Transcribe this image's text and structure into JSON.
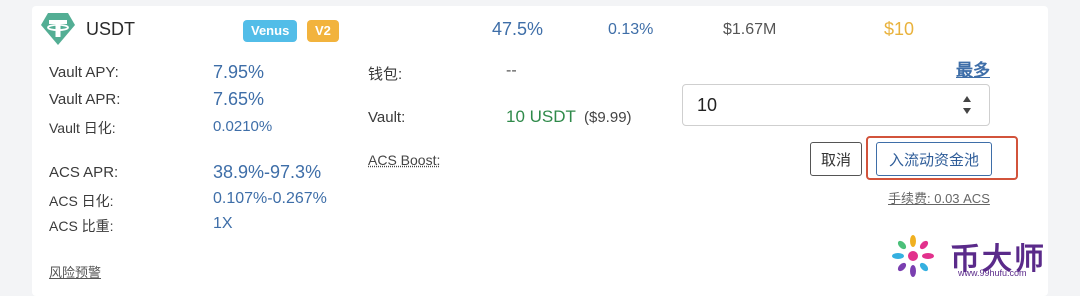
{
  "token": {
    "name": "USDT",
    "logo_icon": "tether-icon",
    "logo_color": "#53ae94"
  },
  "tags": {
    "venus": "Venus",
    "v2": "V2"
  },
  "header": {
    "apy": "47.5%",
    "daily": "0.13%",
    "tvl": "$1.67M",
    "price": "$10"
  },
  "stats": {
    "vault_apy_label": "Vault APY:",
    "vault_apy_value": "7.95%",
    "vault_apr_label": "Vault APR:",
    "vault_apr_value": "7.65%",
    "vault_daily_label": "Vault 日化:",
    "vault_daily_value": "0.0210%",
    "acs_apr_label": "ACS APR:",
    "acs_apr_value": "38.9%-97.3%",
    "acs_daily_label": "ACS 日化:",
    "acs_daily_value": "0.107%-0.267%",
    "acs_weight_label": "ACS 比重:",
    "acs_weight_value": "1X"
  },
  "risk_link": "风险预警",
  "wallet": {
    "label": "钱包:",
    "value": "--"
  },
  "vault": {
    "label": "Vault:",
    "amount": "10 USDT",
    "usd": "($9.99)"
  },
  "boost_label": "ACS Boost:",
  "controls": {
    "max_label": "最多",
    "input_value": "10",
    "cancel_label": "取消",
    "deposit_label": "入流动资金池",
    "fee_label": "手续费: 0.03 ACS"
  },
  "colors": {
    "accent_blue": "#3e6ea8",
    "green": "#2f8a4a",
    "gold": "#e9b23c",
    "highlight_red": "#d2533b",
    "venus_tag": "#52bde8",
    "v2_tag": "#f2b33d"
  },
  "watermark": {
    "title": "币大师",
    "url": "www.99hufu.com"
  }
}
